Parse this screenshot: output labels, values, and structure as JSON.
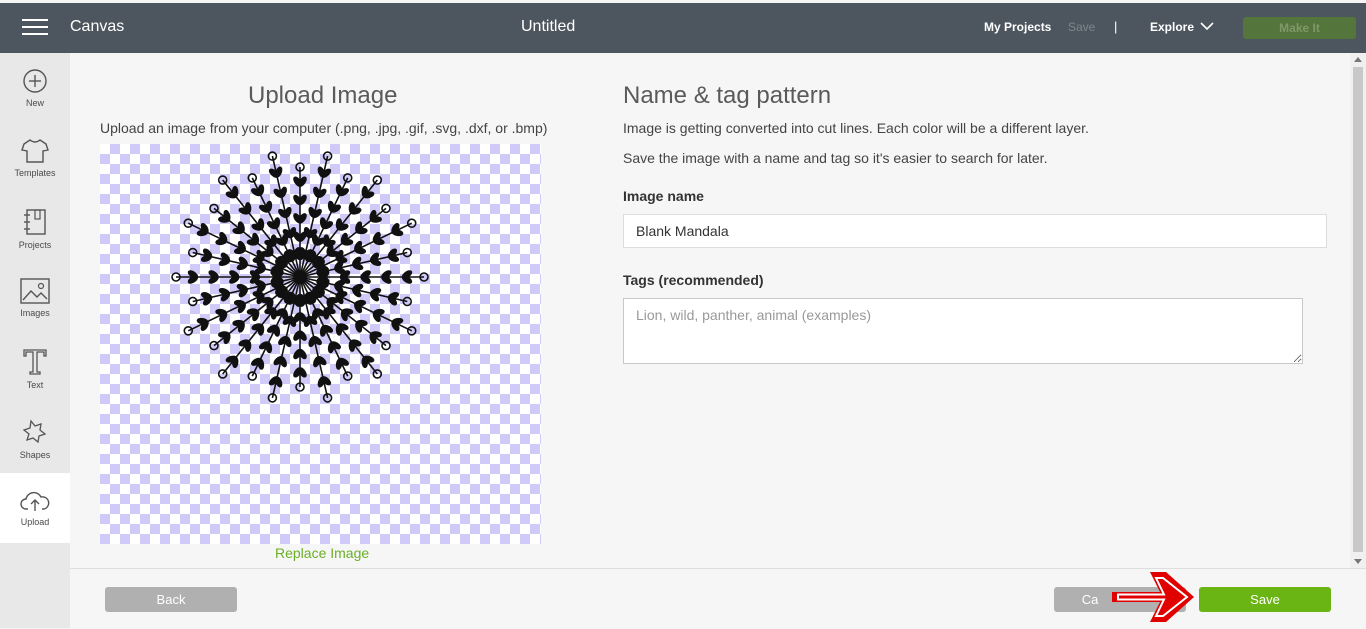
{
  "topbar": {
    "app_title": "Canvas",
    "doc_title": "Untitled",
    "my_projects": "My Projects",
    "save": "Save",
    "separator": "|",
    "explore": "Explore",
    "make_it": "Make It"
  },
  "sidebar": {
    "items": [
      {
        "label": "New",
        "icon": "plus-circle-icon"
      },
      {
        "label": "Templates",
        "icon": "tshirt-icon"
      },
      {
        "label": "Projects",
        "icon": "notebook-icon"
      },
      {
        "label": "Images",
        "icon": "image-icon"
      },
      {
        "label": "Text",
        "icon": "text-t-icon"
      },
      {
        "label": "Shapes",
        "icon": "shapes-icon"
      },
      {
        "label": "Upload",
        "icon": "cloud-upload-icon",
        "active": true
      }
    ]
  },
  "upload": {
    "title": "Upload Image",
    "subtitle": "Upload an image from your computer (.png, .jpg, .gif, .svg, .dxf, or .bmp)",
    "replace": "Replace Image"
  },
  "form": {
    "title": "Name & tag pattern",
    "desc1": "Image is getting converted into cut lines. Each color will be a different layer.",
    "desc2": "Save the image with a name and tag so it's easier to search for later.",
    "name_label": "Image name",
    "name_value": "Blank Mandala",
    "tags_label": "Tags (recommended)",
    "tags_placeholder": "Lion, wild, panther, animal (examples)"
  },
  "footer": {
    "back": "Back",
    "cancel": "Ca",
    "save": "Save"
  },
  "colors": {
    "topbar": "#4d565e",
    "accent_green": "#6ab414",
    "checker_purple": "#cfcaf8"
  }
}
